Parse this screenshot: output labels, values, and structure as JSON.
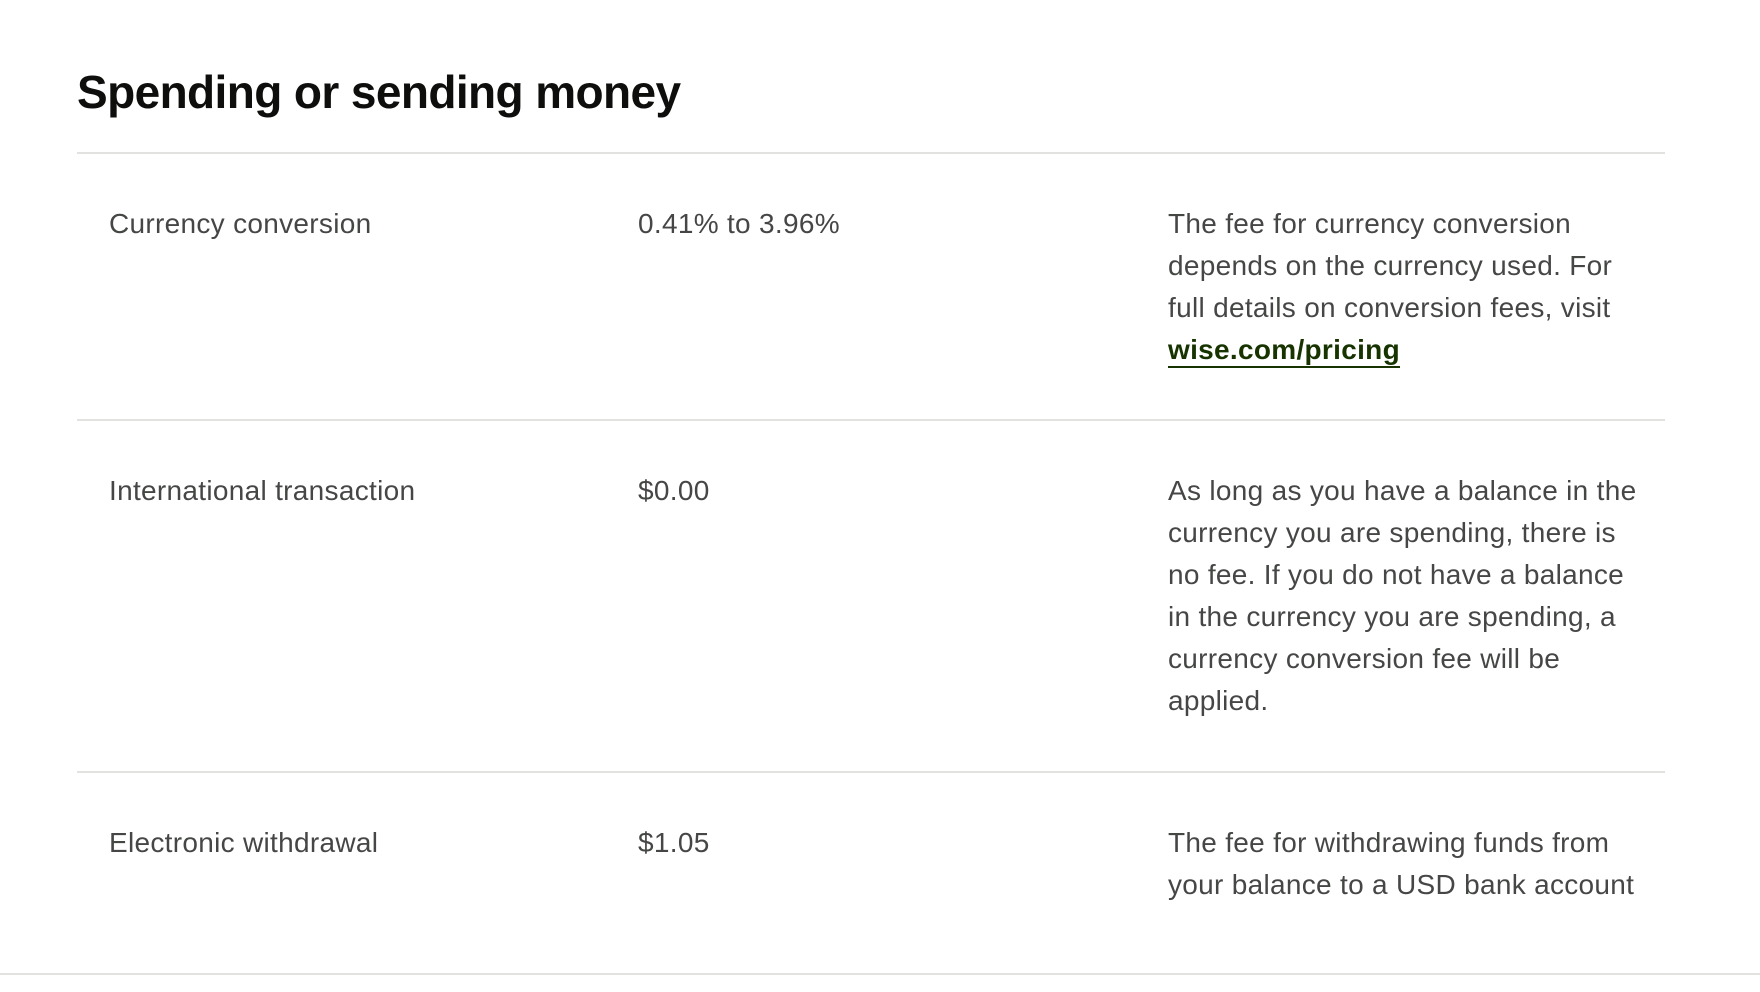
{
  "section": {
    "title": "Spending or sending money"
  },
  "fees": [
    {
      "name": "Currency conversion",
      "amount": "0.41% to 3.96%",
      "description": "The fee for currency conversion depends on the currency used. For full details on conversion fees, visit",
      "link_text": "wise.com/pricing"
    },
    {
      "name": "International transaction",
      "amount": "$0.00",
      "description": "As long as you have a balance in the currency you are spending, there is no fee. If you do not have a balance in the currency you are spending, a currency conversion fee will be applied."
    },
    {
      "name": "Electronic withdrawal",
      "amount": "$1.05",
      "description": "The fee for withdrawing funds from your balance to a USD bank account"
    }
  ],
  "colors": {
    "heading": "#0e0f0c",
    "body_text": "#454745",
    "link": "#163300",
    "divider": "#e2e3e0"
  }
}
